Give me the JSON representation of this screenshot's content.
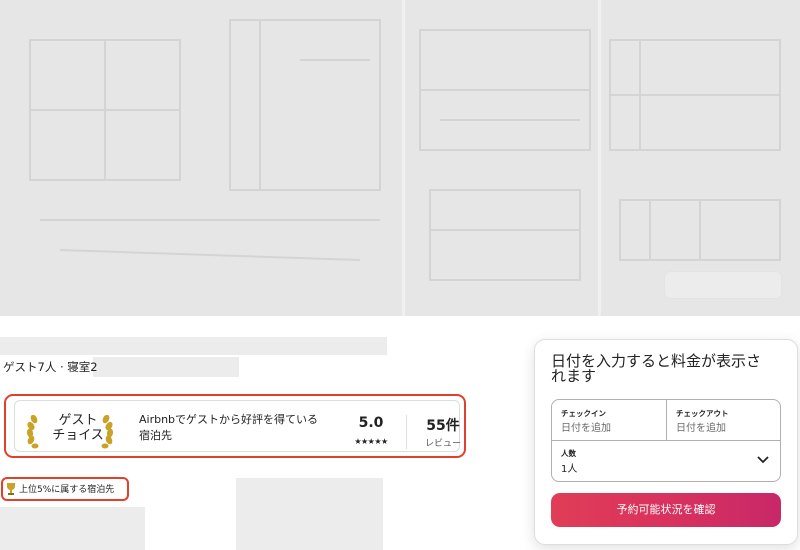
{
  "listing": {
    "subtitle": "ゲスト7人 · 寝室2"
  },
  "guest_favorite": {
    "badge_line1": "ゲスト",
    "badge_line2": "チョイス",
    "description": "Airbnbでゲストから好評を得ている宿泊先",
    "rating": "5.0",
    "stars": "★★★★★",
    "review_count": "55件",
    "review_label": "レビュー"
  },
  "top_badge": {
    "label": "上位5%に属する宿泊先"
  },
  "booking": {
    "title": "日付を入力すると料金が表示されます",
    "checkin_label": "チェックイン",
    "checkin_placeholder": "日付を追加",
    "checkout_label": "チェックアウト",
    "checkout_placeholder": "日付を追加",
    "guests_label": "人数",
    "guests_value": "1人",
    "reserve_button": "予約可能状況を確認"
  },
  "colors": {
    "highlight_outline": "#e1402a",
    "reserve_gradient_start": "#e03d57",
    "reserve_gradient_end": "#c72868"
  },
  "icons": {
    "laurel": "laurel-icon",
    "trophy": "trophy-icon",
    "chevron": "chevron-down-icon"
  }
}
